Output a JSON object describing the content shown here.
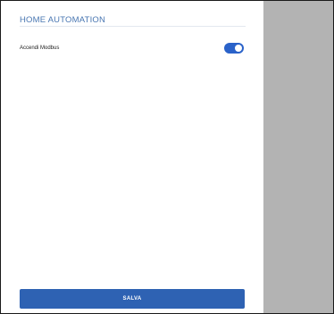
{
  "section": {
    "title": "HOME AUTOMATION"
  },
  "settings": [
    {
      "label": "Accendi Modbus",
      "enabled": true
    }
  ],
  "actions": {
    "save_label": "SALVA"
  },
  "colors": {
    "accent": "#2a62c9",
    "title": "#4a77b2",
    "side_panel": "#b3b3b3",
    "button": "#2e62b3"
  }
}
